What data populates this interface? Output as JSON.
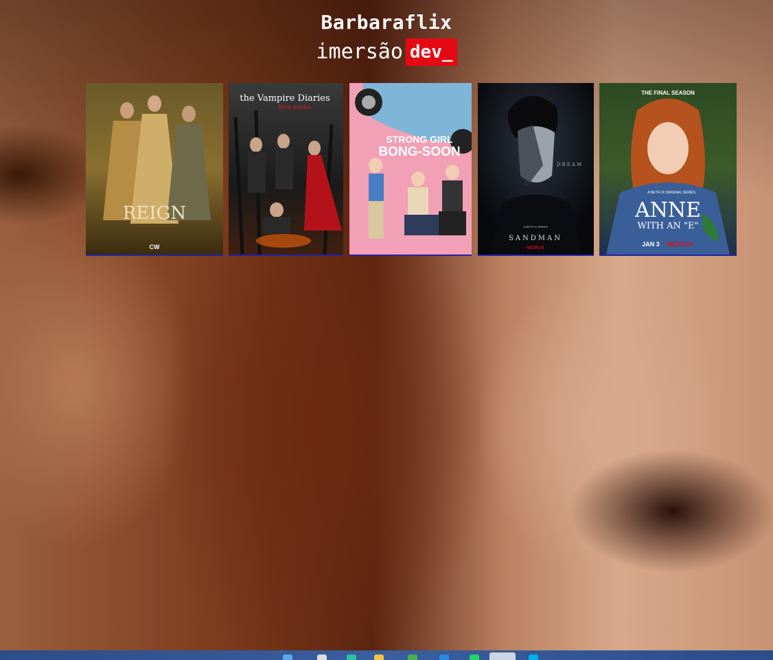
{
  "header": {
    "title": "Barbaraflix",
    "tagline_word": "imersão",
    "tagline_badge": "dev_"
  },
  "colors": {
    "accent": "#e50914"
  },
  "posters": [
    {
      "name": "poster-reign",
      "texts": [
        "REIGN",
        "CW"
      ]
    },
    {
      "name": "poster-vampire-diaries",
      "texts": [
        "the Vampire Diaries",
        "love sucks"
      ]
    },
    {
      "name": "poster-strong-girl-bong-soon",
      "texts": [
        "STRONG GIRL",
        "BONG-SOON"
      ]
    },
    {
      "name": "poster-sandman",
      "texts": [
        "DREAM",
        "A NETFLIX SERIES",
        "SANDMAN",
        "NETFLIX"
      ]
    },
    {
      "name": "poster-anne-with-an-e",
      "texts": [
        "THE FINAL SEASON",
        "A NETFLIX ORIGINAL SERIES",
        "ANNE",
        "WITH AN \"E\"",
        "JAN 3",
        "NETFLIX"
      ]
    }
  ],
  "taskbar": {
    "icons": [
      "file-explorer-icon",
      "search-icon",
      "edge-icon",
      "folder-icon",
      "chrome-icon",
      "vscode-icon",
      "whatsapp-icon",
      "app-active-icon",
      "skype-icon"
    ]
  }
}
